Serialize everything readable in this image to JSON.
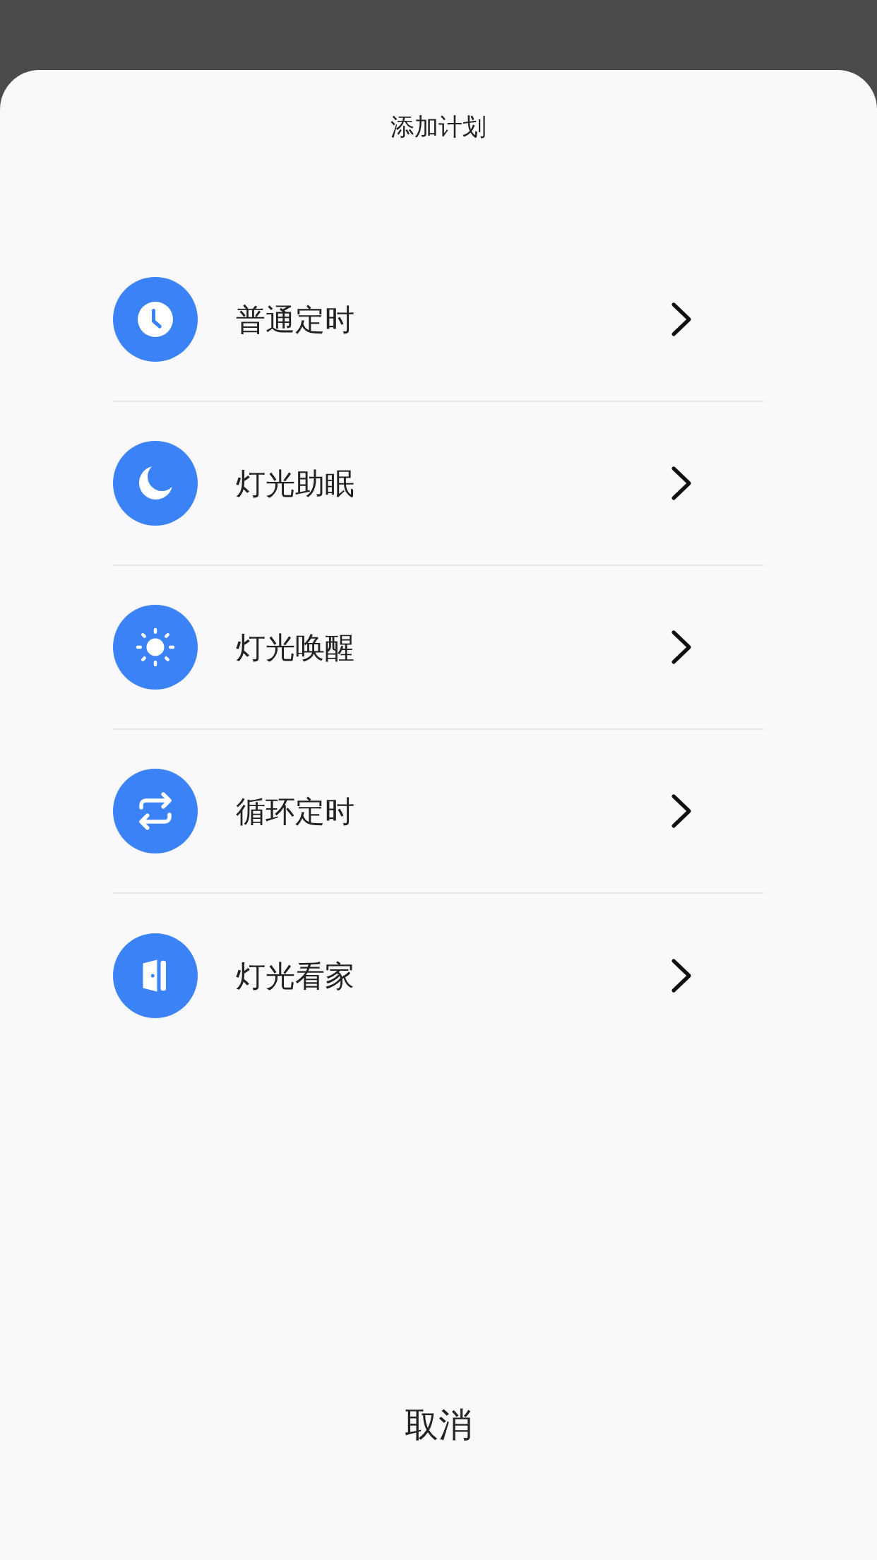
{
  "sheet": {
    "title": "添加计划",
    "items": [
      {
        "kind": "clock",
        "label": "普通定时"
      },
      {
        "kind": "moon",
        "label": "灯光助眠"
      },
      {
        "kind": "sun",
        "label": "灯光唤醒"
      },
      {
        "kind": "repeat",
        "label": "循环定时"
      },
      {
        "kind": "door",
        "label": "灯光看家"
      }
    ],
    "cancel": "取消"
  }
}
